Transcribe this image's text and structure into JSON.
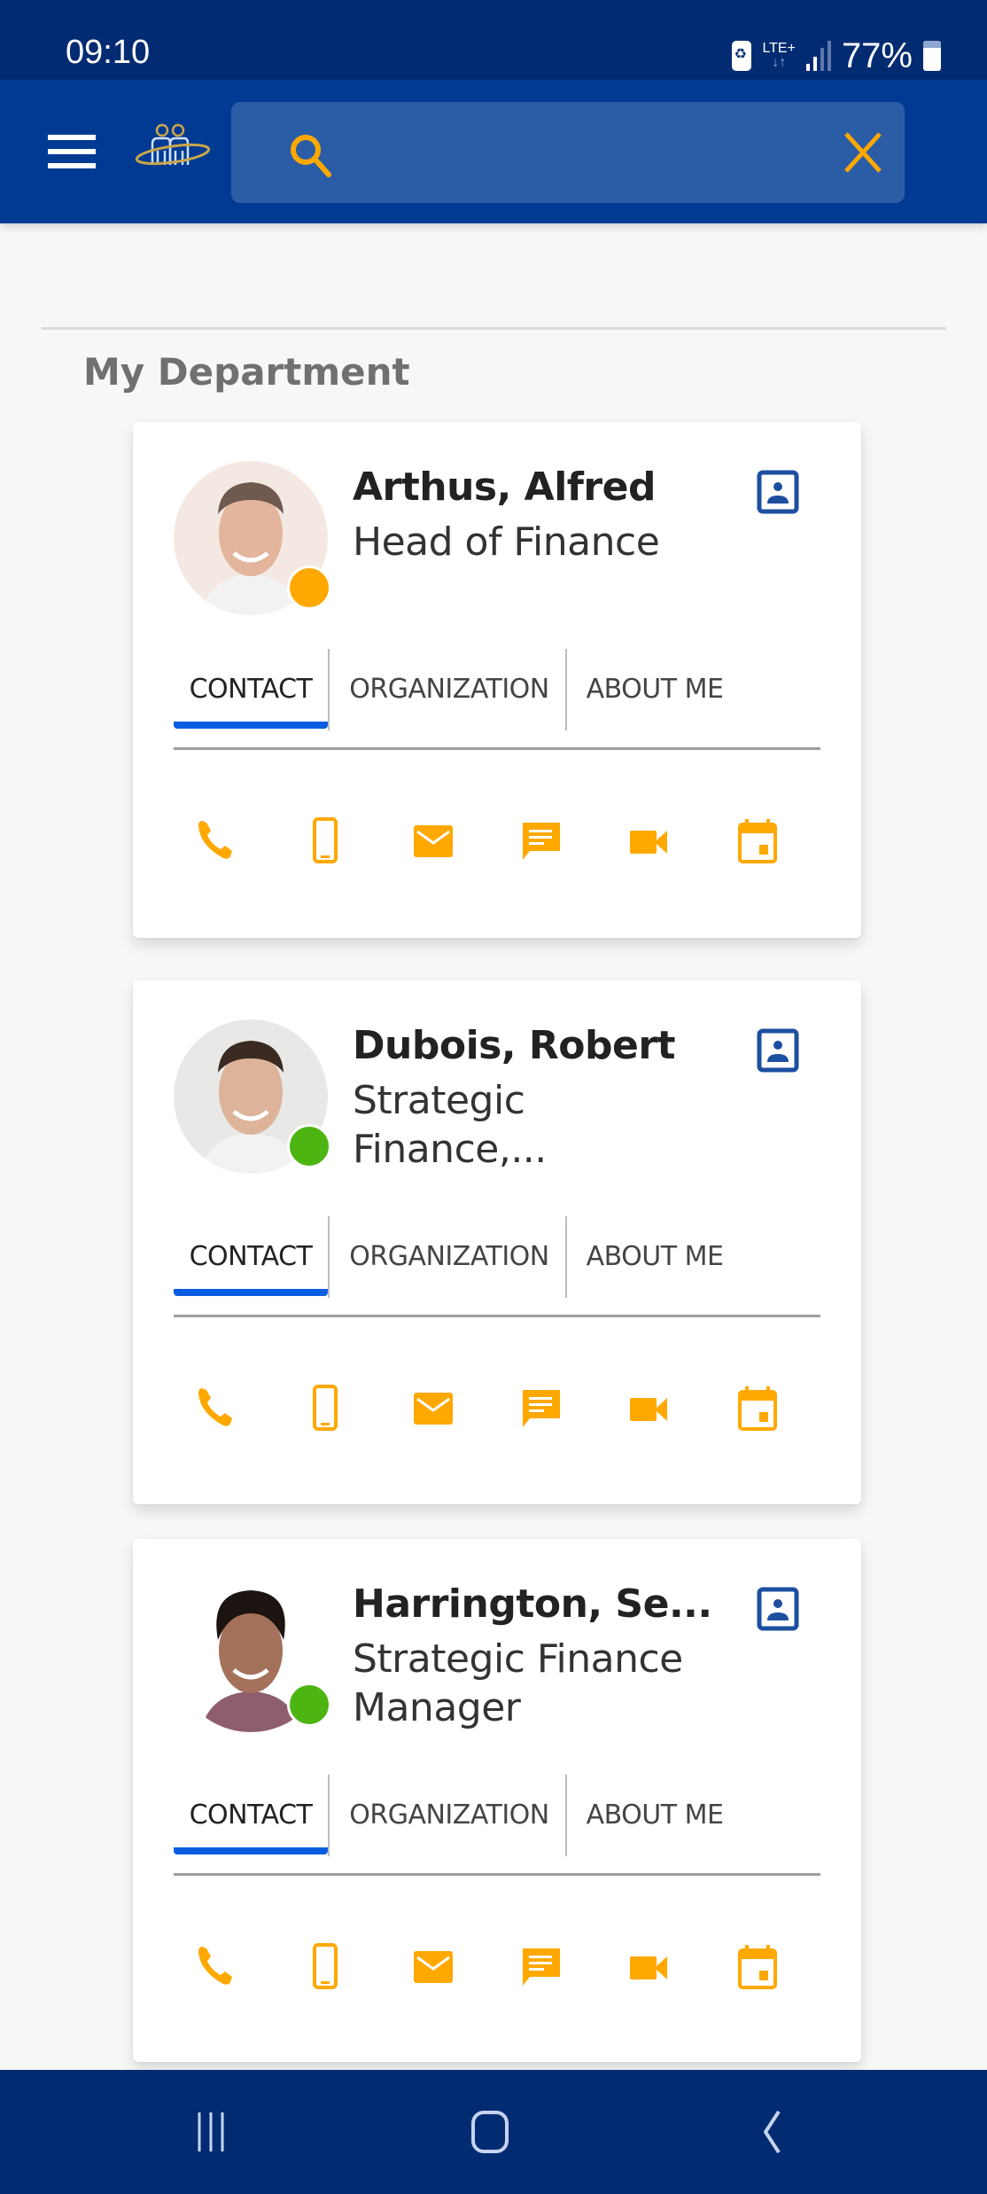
{
  "status_bar": {
    "time": "09:10",
    "network": "LTE+",
    "network_arrows": "↓↑",
    "battery_percent": "77%"
  },
  "app_bar": {
    "menu_icon": "hamburger-menu-icon",
    "logo": "people-orbit-logo",
    "search": {
      "value": "",
      "placeholder": "",
      "search_icon": "search-icon",
      "clear_icon": "close-icon"
    }
  },
  "colors": {
    "status_bar_bg": "#032B72",
    "app_bar_bg": "#003A93",
    "search_bg": "#2B5CA6",
    "accent_orange": "#FFA800",
    "tab_indicator": "#0A5CE0",
    "presence_away": "#FFA800",
    "presence_available": "#4CB512",
    "contact_card_icon": "#1C4FA0"
  },
  "section": {
    "title": "My Department"
  },
  "people": [
    {
      "name": "Arthus, Alfred",
      "title": "Head of Finance",
      "presence": "away",
      "presence_color": "#FFA800",
      "tabs": [
        "CONTACT",
        "ORGANIZATION",
        "ABOUT ME"
      ],
      "active_tab": "CONTACT",
      "actions": [
        "phone-icon",
        "mobile-icon",
        "email-icon",
        "chat-icon",
        "video-call-icon",
        "calendar-icon"
      ]
    },
    {
      "name": "Dubois, Robert",
      "title": "Strategic Finance,...",
      "presence": "available",
      "presence_color": "#4CB512",
      "tabs": [
        "CONTACT",
        "ORGANIZATION",
        "ABOUT ME"
      ],
      "active_tab": "CONTACT",
      "actions": [
        "phone-icon",
        "mobile-icon",
        "email-icon",
        "chat-icon",
        "video-call-icon",
        "calendar-icon"
      ]
    },
    {
      "name": "Harrington, Se...",
      "title": "Strategic Finance Manager",
      "presence": "available",
      "presence_color": "#4CB512",
      "tabs": [
        "CONTACT",
        "ORGANIZATION",
        "ABOUT ME"
      ],
      "active_tab": "CONTACT",
      "actions": [
        "phone-icon",
        "mobile-icon",
        "email-icon",
        "chat-icon",
        "video-call-icon",
        "calendar-icon"
      ]
    }
  ],
  "nav_bar": {
    "buttons": [
      "recent-apps-icon",
      "home-icon",
      "back-icon"
    ]
  }
}
